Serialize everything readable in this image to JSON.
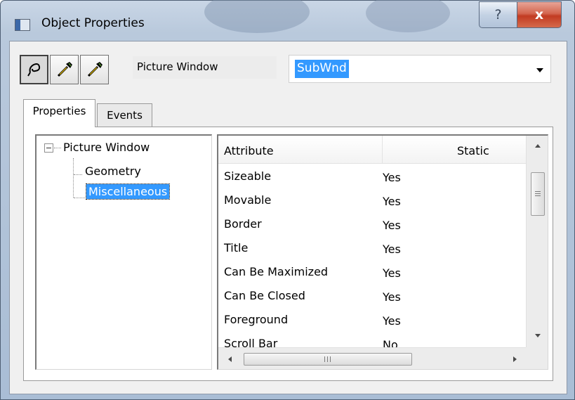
{
  "window": {
    "title": "Object Properties",
    "help_glyph": "?",
    "close_glyph": "x"
  },
  "toolbar": {
    "buttons": [
      {
        "icon": "pin-icon",
        "pressed": true
      },
      {
        "icon": "pipette-icon",
        "pressed": false
      },
      {
        "icon": "pipette-icon",
        "pressed": false
      }
    ]
  },
  "object": {
    "type_label": "Picture Window",
    "name": "SubWnd"
  },
  "tabs": [
    {
      "label": "Properties",
      "active": true
    },
    {
      "label": "Events",
      "active": false
    }
  ],
  "tree": {
    "root": "Picture Window",
    "children": [
      {
        "label": "Geometry",
        "selected": false
      },
      {
        "label": "Miscellaneous",
        "selected": true
      }
    ]
  },
  "attributes": {
    "columns": [
      "Attribute",
      "Static"
    ],
    "rows": [
      {
        "attribute": "Sizeable",
        "static": "Yes"
      },
      {
        "attribute": "Movable",
        "static": "Yes"
      },
      {
        "attribute": "Border",
        "static": "Yes"
      },
      {
        "attribute": "Title",
        "static": "Yes"
      },
      {
        "attribute": "Can Be Maximized",
        "static": "Yes"
      },
      {
        "attribute": "Can Be Closed",
        "static": "Yes"
      },
      {
        "attribute": "Foreground",
        "static": "Yes"
      },
      {
        "attribute": "Scroll Bar",
        "static": "No"
      }
    ]
  },
  "colors": {
    "selection": "#3399ff",
    "close_button": "#c23b22"
  }
}
